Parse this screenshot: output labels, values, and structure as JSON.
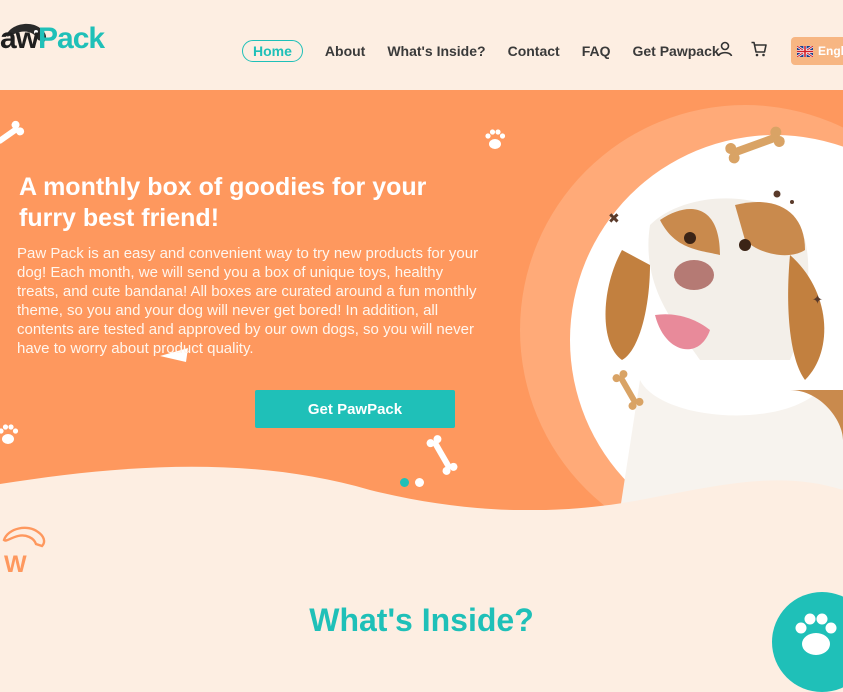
{
  "brand": {
    "logo_dark": "aw",
    "logo_accent": "Pack",
    "accent_color": "#1fc0b8",
    "hero_color": "#fe985e"
  },
  "nav": {
    "items": [
      {
        "label": "Home",
        "active": true
      },
      {
        "label": "About"
      },
      {
        "label": "What's Inside?"
      },
      {
        "label": "Contact"
      },
      {
        "label": "FAQ"
      },
      {
        "label": "Get Pawpack"
      }
    ],
    "language": "English"
  },
  "hero": {
    "title": "A monthly box of goodies for your furry best friend!",
    "text": "Paw Pack is an easy and convenient way to try new products for your dog! Each month, we will send you a box of unique toys, healthy treats, and cute bandana! All boxes are curated around a fun monthly theme, so you and your dog will never get bored! In addition, all contents are tested and approved by our own dogs, so you will never have to worry about product quality.",
    "cta_label": "Get PawPack"
  },
  "carousel": {
    "slides": 2,
    "active_index": 0
  },
  "section": {
    "title": "What's Inside?"
  },
  "icons": [
    "user-icon",
    "cart-icon",
    "uk-flag-icon",
    "bone-icon",
    "paw-icon",
    "dog-logo-icon"
  ]
}
